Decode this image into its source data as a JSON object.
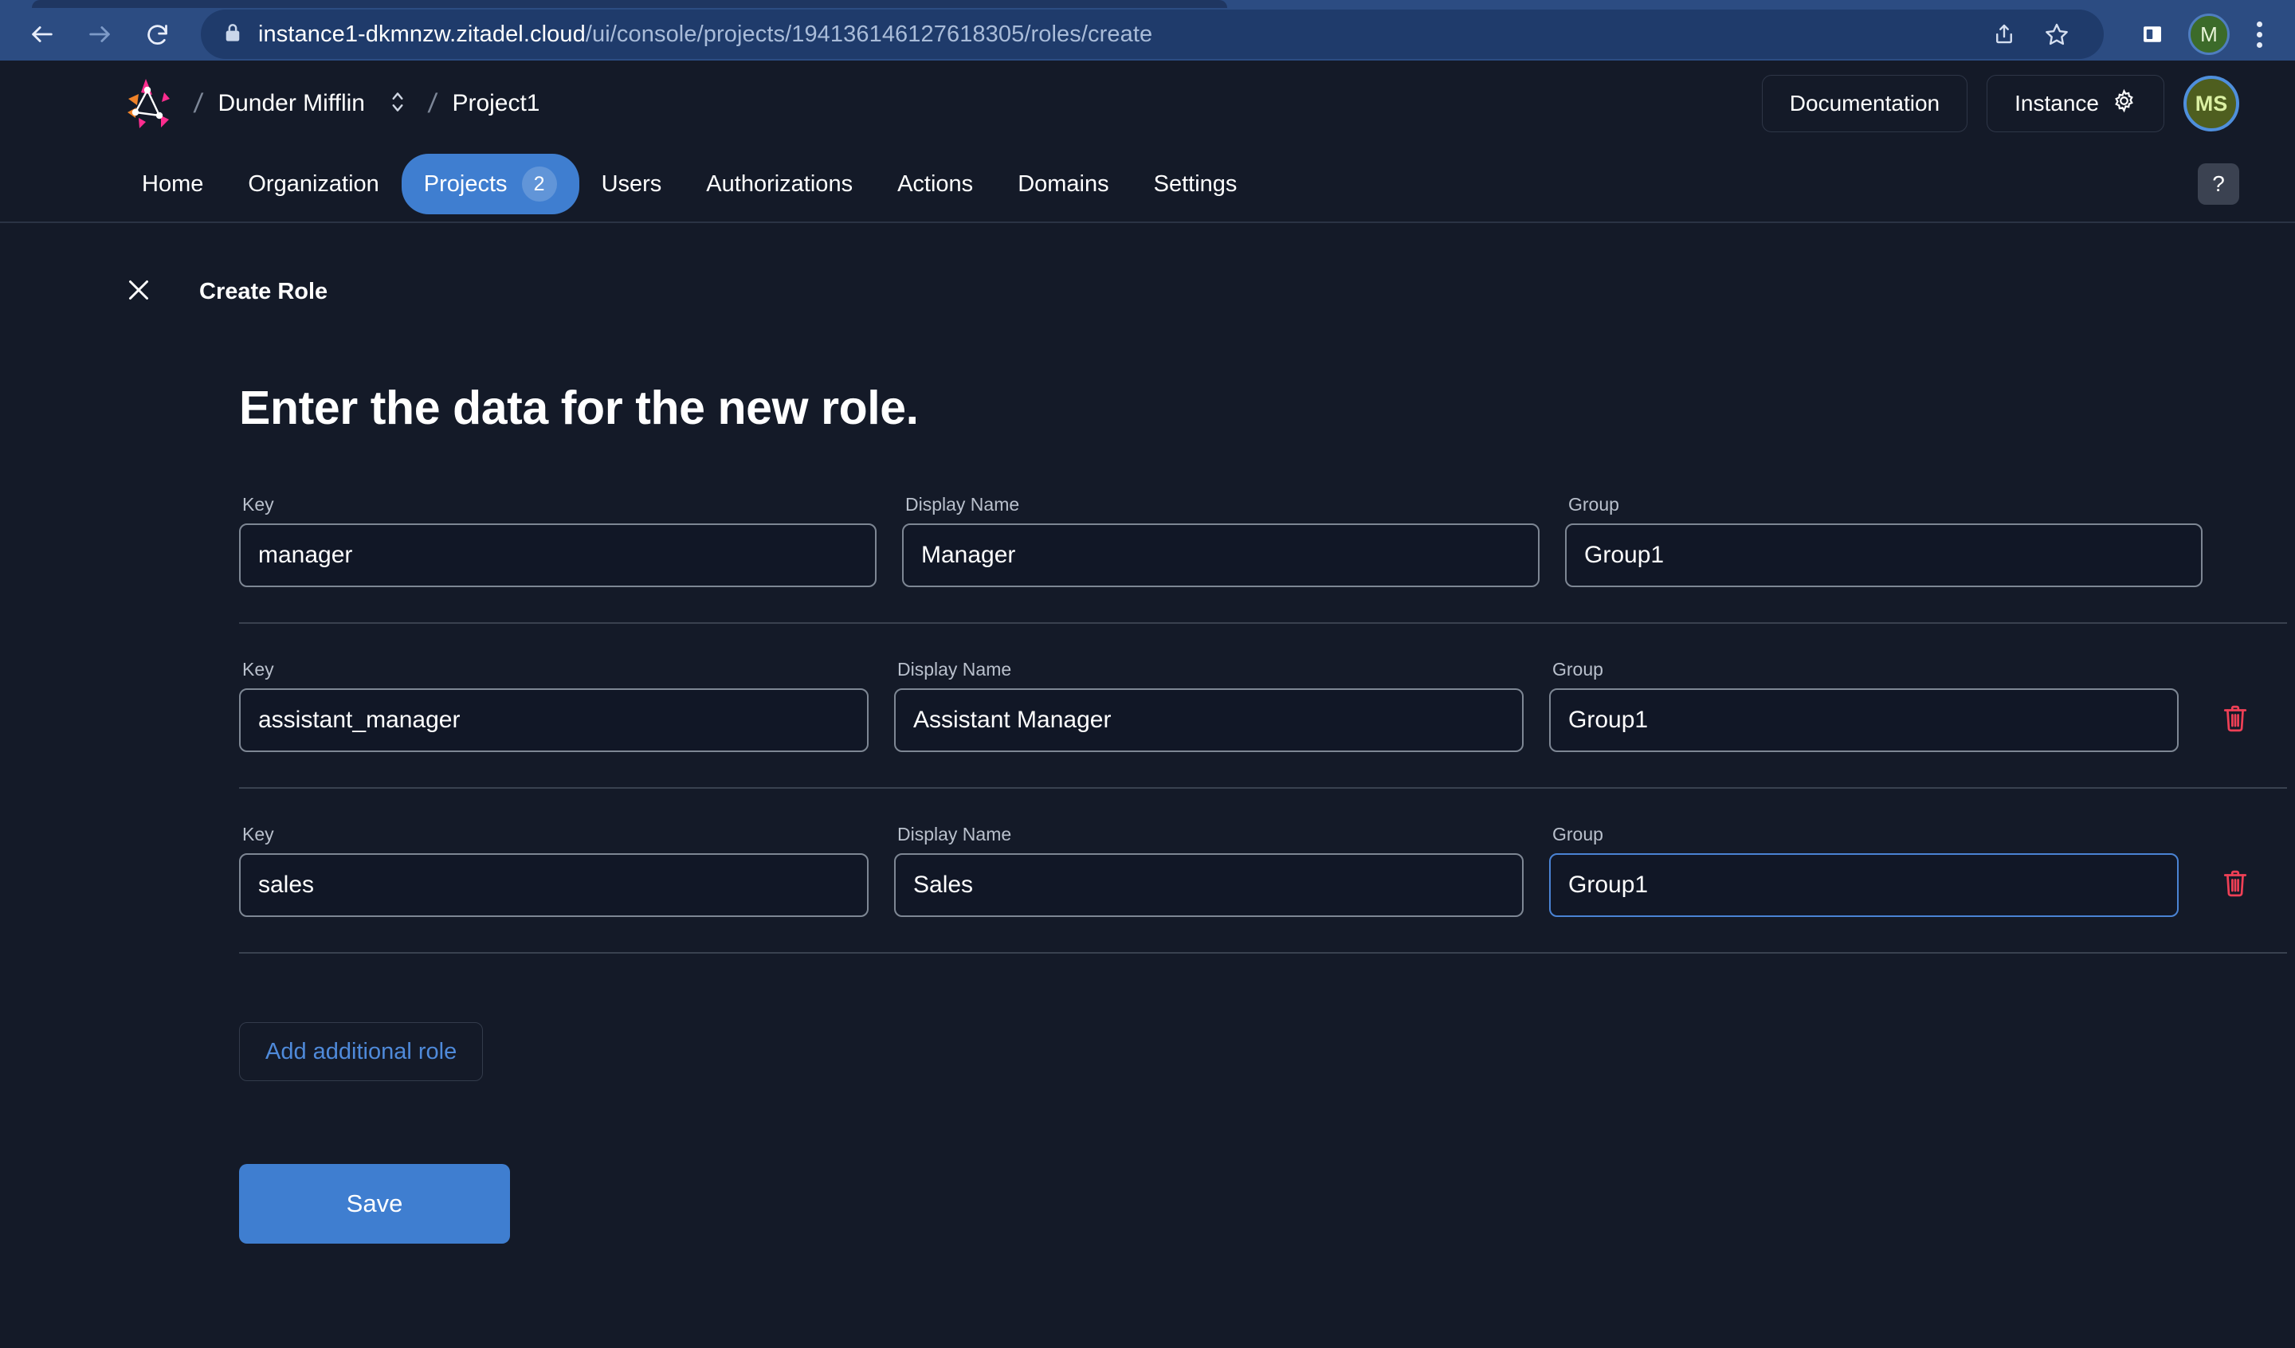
{
  "browser": {
    "back_icon": "arrow-left-icon",
    "forward_icon": "arrow-right-icon",
    "reload_icon": "reload-icon",
    "lock_icon": "lock-icon",
    "url_host": "instance1-dkmnzw.zitadel.cloud",
    "url_path": "/ui/console/projects/194136146127618305/roles/create",
    "share_icon": "share-icon",
    "bookmark_icon": "star-icon",
    "sidepanel_icon": "side-panel-icon",
    "profile_initial": "M",
    "menu_icon": "kebab-menu-icon"
  },
  "header": {
    "logo_icon": "zitadel-logo-icon",
    "separator": "/",
    "org_name": "Dunder Mifflin",
    "org_switch_icon": "chevron-up-down-icon",
    "project_name": "Project1",
    "documentation_label": "Documentation",
    "instance_label": "Instance",
    "instance_icon": "gear-icon",
    "avatar_initials": "MS"
  },
  "nav": {
    "items": [
      {
        "label": "Home",
        "active": false,
        "badge": null
      },
      {
        "label": "Organization",
        "active": false,
        "badge": null
      },
      {
        "label": "Projects",
        "active": true,
        "badge": "2"
      },
      {
        "label": "Users",
        "active": false,
        "badge": null
      },
      {
        "label": "Authorizations",
        "active": false,
        "badge": null
      },
      {
        "label": "Actions",
        "active": false,
        "badge": null
      },
      {
        "label": "Domains",
        "active": false,
        "badge": null
      },
      {
        "label": "Settings",
        "active": false,
        "badge": null
      }
    ],
    "help_label": "?"
  },
  "page": {
    "close_icon": "close-icon",
    "breadcrumb_label": "Create Role",
    "title": "Enter the data for the new role."
  },
  "form": {
    "labels": {
      "key": "Key",
      "display_name": "Display Name",
      "group": "Group"
    },
    "rows": [
      {
        "key": "manager",
        "display_name": "Manager",
        "group": "Group1",
        "deletable": false,
        "focused_field": null
      },
      {
        "key": "assistant_manager",
        "display_name": "Assistant Manager",
        "group": "Group1",
        "deletable": true,
        "delete_icon": "trash-icon",
        "focused_field": null
      },
      {
        "key": "sales",
        "display_name": "Sales",
        "group": "Group1",
        "deletable": true,
        "delete_icon": "trash-icon",
        "focused_field": "group"
      }
    ],
    "add_role_label": "Add additional role",
    "save_label": "Save"
  },
  "colors": {
    "page_bg": "#141a28",
    "accent_blue": "#3f7ed0",
    "link_blue": "#4f8ada",
    "danger_red": "#ef4056",
    "browser_blue": "#2c4c82",
    "avatar_green": "#4e5e1f"
  }
}
